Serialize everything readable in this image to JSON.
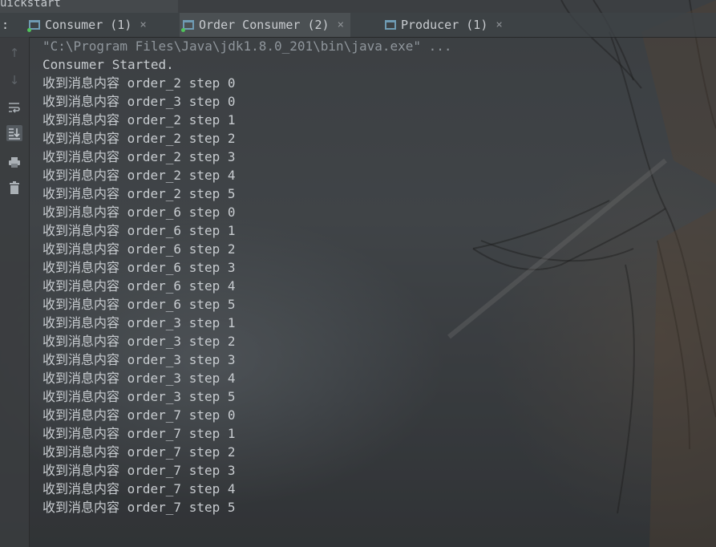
{
  "top_strip_text": "uickstart",
  "tabs": {
    "prefix": ":",
    "items": [
      {
        "label": "Consumer (1)",
        "close": "×"
      },
      {
        "label": "Order Consumer (2)",
        "close": "×"
      },
      {
        "label": "Producer (1)",
        "close": "×"
      }
    ]
  },
  "toolbar": {
    "icons": [
      "arrow-up-icon",
      "arrow-down-icon",
      "soft-wrap-icon",
      "scroll-to-end-icon",
      "print-icon",
      "trash-icon"
    ]
  },
  "console": {
    "command": "\"C:\\Program Files\\Java\\jdk1.8.0_201\\bin\\java.exe\" ...",
    "started": "Consumer Started.",
    "lines": [
      "收到消息内容 order_2 step 0",
      "收到消息内容 order_3 step 0",
      "收到消息内容 order_2 step 1",
      "收到消息内容 order_2 step 2",
      "收到消息内容 order_2 step 3",
      "收到消息内容 order_2 step 4",
      "收到消息内容 order_2 step 5",
      "收到消息内容 order_6 step 0",
      "收到消息内容 order_6 step 1",
      "收到消息内容 order_6 step 2",
      "收到消息内容 order_6 step 3",
      "收到消息内容 order_6 step 4",
      "收到消息内容 order_6 step 5",
      "收到消息内容 order_3 step 1",
      "收到消息内容 order_3 step 2",
      "收到消息内容 order_3 step 3",
      "收到消息内容 order_3 step 4",
      "收到消息内容 order_3 step 5",
      "收到消息内容 order_7 step 0",
      "收到消息内容 order_7 step 1",
      "收到消息内容 order_7 step 2",
      "收到消息内容 order_7 step 3",
      "收到消息内容 order_7 step 4",
      "收到消息内容 order_7 step 5"
    ]
  }
}
